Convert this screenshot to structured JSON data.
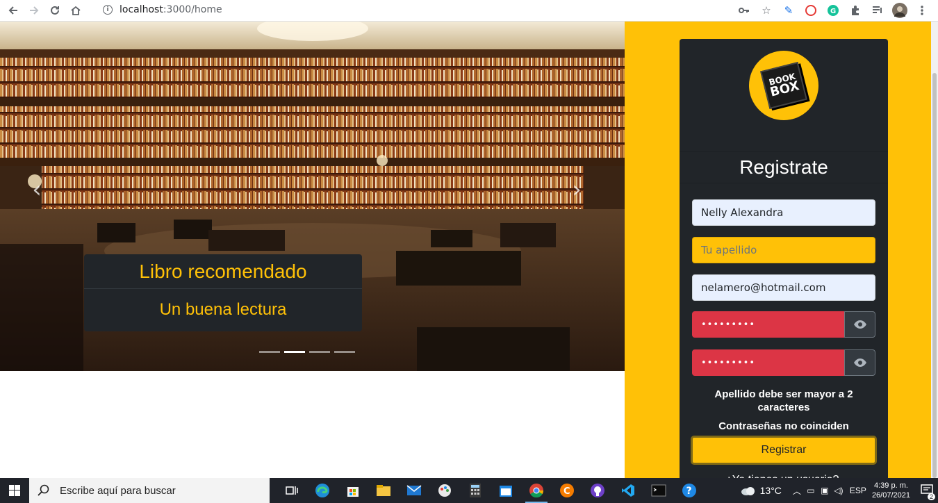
{
  "browser": {
    "url_host": "localhost",
    "url_rest": ":3000/home"
  },
  "carousel": {
    "caption_title": "Libro recomendado",
    "caption_subtitle": "Un buena lectura",
    "prev_glyph": "‹",
    "next_glyph": "›",
    "slide_count": 4,
    "active_index": 1
  },
  "form": {
    "logo_line1": "BOOK",
    "logo_line2": "BOX",
    "title": "Registrate",
    "name_value": "Nelly Alexandra",
    "lastname_placeholder": "Tu apellido",
    "email_value": "nelamero@hotmail.com",
    "password_mask": "•••••••••",
    "password_confirm_mask": "•••••••••",
    "error_lastname": "Apellido debe ser mayor a 2 caracteres",
    "error_password": "Contraseñas no coinciden",
    "submit_label": "Registrar",
    "login_link": "¿Ya tienes un usuario?."
  },
  "taskbar": {
    "search_placeholder": "Escribe aquí para buscar",
    "temperature": "13°C",
    "language": "ESP",
    "time": "4:39 p. m.",
    "date": "26/07/2021",
    "notification_count": "2"
  },
  "colors": {
    "accent": "#ffc107",
    "card": "#212529",
    "error": "#dc3545"
  }
}
